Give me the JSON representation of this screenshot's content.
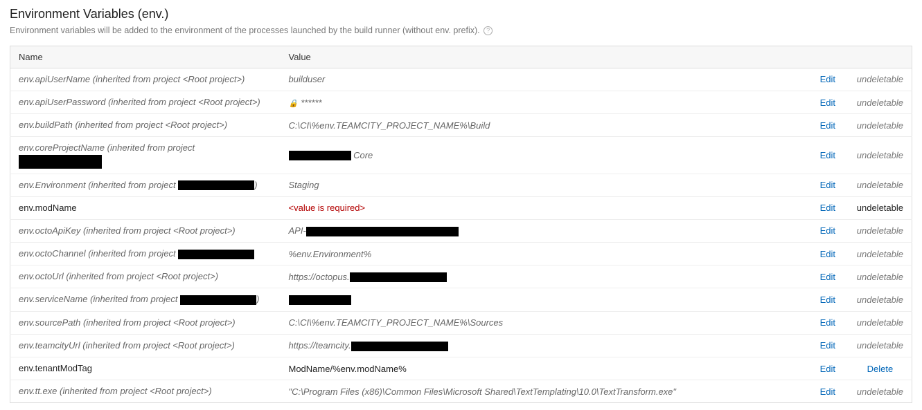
{
  "section": {
    "title": "Environment Variables (env.)",
    "description": "Environment variables will be added to the environment of the processes launched by the build runner (without env. prefix)."
  },
  "table": {
    "headers": {
      "name": "Name",
      "value": "Value"
    },
    "edit_label": "Edit",
    "undeletable_label": "undeletable",
    "delete_label": "Delete",
    "rows": [
      {
        "name_prefix": "env.apiUserName",
        "name_suffix": " (inherited from project <Root project>)",
        "value": "builduser",
        "inherited": true,
        "redact_name": false,
        "redact_value": false,
        "deletable": false
      },
      {
        "name_prefix": "env.apiUserPassword",
        "name_suffix": " (inherited from project <Root project>)",
        "value": "******",
        "inherited": true,
        "redact_name": false,
        "redact_value": false,
        "locked": true,
        "deletable": false
      },
      {
        "name_prefix": "env.buildPath",
        "name_suffix": " (inherited from project <Root project>)",
        "value": "C:\\CI\\%env.TEAMCITY_PROJECT_NAME%\\Build",
        "inherited": true,
        "redact_name": false,
        "redact_value": false,
        "deletable": false
      },
      {
        "name_prefix": "env.coreProjectName",
        "name_suffix": " (inherited from project ",
        "name_redact_after": true,
        "value_prefix": "",
        "value_redact": true,
        "value_suffix": " Core",
        "inherited": true,
        "deletable": false,
        "second_line_redact": true
      },
      {
        "name_prefix": "env.Environment",
        "name_suffix": " (inherited from project ",
        "name_redact_mid": true,
        "name_suffix_end": ")",
        "value": "Staging",
        "inherited": true,
        "deletable": false
      },
      {
        "name_prefix": "env.modName",
        "value": "<value is required>",
        "inherited": false,
        "required": true,
        "deletable": false
      },
      {
        "name_prefix": "env.octoApiKey",
        "name_suffix": " (inherited from project <Root project>)",
        "value_prefix": "API-",
        "value_redact": true,
        "inherited": true,
        "deletable": false
      },
      {
        "name_prefix": "env.octoChannel",
        "name_suffix": " (inherited from project ",
        "name_redact_mid": true,
        "value": "%env.Environment%",
        "inherited": true,
        "deletable": false
      },
      {
        "name_prefix": "env.octoUrl",
        "name_suffix": " (inherited from project <Root project>)",
        "value_prefix": "https://octopus.",
        "value_redact": true,
        "inherited": true,
        "deletable": false
      },
      {
        "name_prefix": "env.serviceName",
        "name_suffix": " (inherited from project ",
        "name_redact_mid": true,
        "name_suffix_end": ")",
        "value_redact_only": true,
        "inherited": true,
        "deletable": false
      },
      {
        "name_prefix": "env.sourcePath",
        "name_suffix": " (inherited from project <Root project>)",
        "value": "C:\\CI\\%env.TEAMCITY_PROJECT_NAME%\\Sources",
        "inherited": true,
        "deletable": false
      },
      {
        "name_prefix": "env.teamcityUrl",
        "name_suffix": " (inherited from project <Root project>)",
        "value_prefix": "https://teamcity.",
        "value_redact": true,
        "inherited": true,
        "deletable": false
      },
      {
        "name_prefix": "env.tenantModTag",
        "value": "ModName/%env.modName%",
        "inherited": false,
        "deletable": true
      },
      {
        "name_prefix": "env.tt.exe",
        "name_suffix": " (inherited from project <Root project>)",
        "value": "\"C:\\Program Files (x86)\\Common Files\\Microsoft Shared\\TextTemplating\\10.0\\TextTransform.exe\"",
        "inherited": true,
        "deletable": false
      }
    ]
  }
}
